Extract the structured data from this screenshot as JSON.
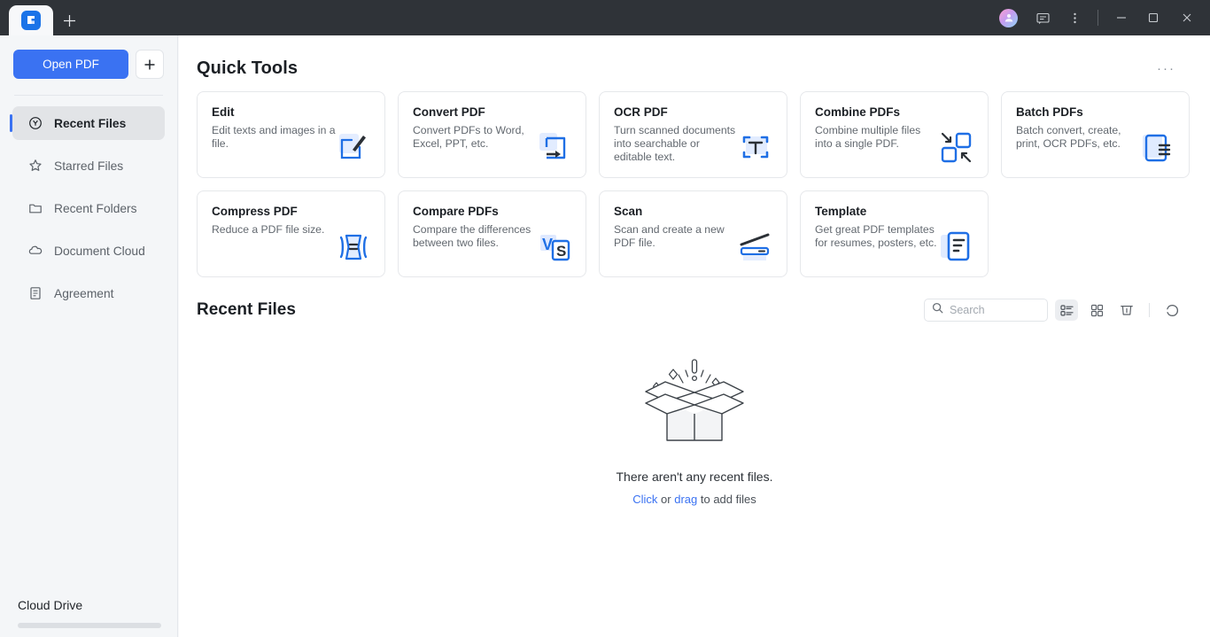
{
  "titlebar": {
    "app_icon": "pdfelement-app-icon",
    "new_tab_label": "+",
    "avatar": "user-avatar",
    "feedback_icon": "feedback-icon",
    "menu_icon": "vertical-dots-icon",
    "minimize_label": "minimize",
    "maximize_label": "maximize",
    "close_label": "close"
  },
  "sidebar": {
    "open_pdf_label": "Open PDF",
    "add_label": "+",
    "items": [
      {
        "label": "Recent Files",
        "icon": "clock-icon",
        "active": true
      },
      {
        "label": "Starred Files",
        "icon": "star-icon",
        "active": false
      },
      {
        "label": "Recent Folders",
        "icon": "folder-icon",
        "active": false
      },
      {
        "label": "Document Cloud",
        "icon": "cloud-icon",
        "active": false
      },
      {
        "label": "Agreement",
        "icon": "document-icon",
        "active": false
      }
    ],
    "cloud_drive_label": "Cloud Drive"
  },
  "quick_tools": {
    "title": "Quick Tools",
    "more_label": "···",
    "cards": [
      {
        "title": "Edit",
        "desc": "Edit texts and images in a file.",
        "icon": "edit-tool-icon"
      },
      {
        "title": "Convert PDF",
        "desc": "Convert PDFs to Word, Excel, PPT, etc.",
        "icon": "convert-tool-icon"
      },
      {
        "title": "OCR PDF",
        "desc": "Turn scanned documents into searchable or editable text.",
        "icon": "ocr-tool-icon"
      },
      {
        "title": "Combine PDFs",
        "desc": "Combine multiple files into a single PDF.",
        "icon": "combine-tool-icon"
      },
      {
        "title": "Batch PDFs",
        "desc": "Batch convert, create, print, OCR PDFs, etc.",
        "icon": "batch-tool-icon"
      },
      {
        "title": "Compress PDF",
        "desc": "Reduce a PDF file size.",
        "icon": "compress-tool-icon"
      },
      {
        "title": "Compare PDFs",
        "desc": "Compare the differences between two files.",
        "icon": "compare-tool-icon"
      },
      {
        "title": "Scan",
        "desc": "Scan and create a new PDF file.",
        "icon": "scan-tool-icon"
      },
      {
        "title": "Template",
        "desc": "Get great PDF templates for resumes, posters, etc.",
        "icon": "template-tool-icon"
      }
    ]
  },
  "recent_files": {
    "title": "Recent Files",
    "search_placeholder": "Search",
    "search_value": "",
    "view_list_icon": "list-view-icon",
    "view_grid_icon": "grid-view-icon",
    "trash_icon": "trash-icon",
    "refresh_icon": "refresh-icon",
    "empty_message": "There aren't any recent files.",
    "empty_hint_click": "Click",
    "empty_hint_or": " or ",
    "empty_hint_drag": "drag",
    "empty_hint_tail": " to add files"
  },
  "colors": {
    "accent": "#3a72f2",
    "titlebar": "#2f3338",
    "sidebar": "#f4f6f8",
    "card_border": "#e6e8eb"
  }
}
